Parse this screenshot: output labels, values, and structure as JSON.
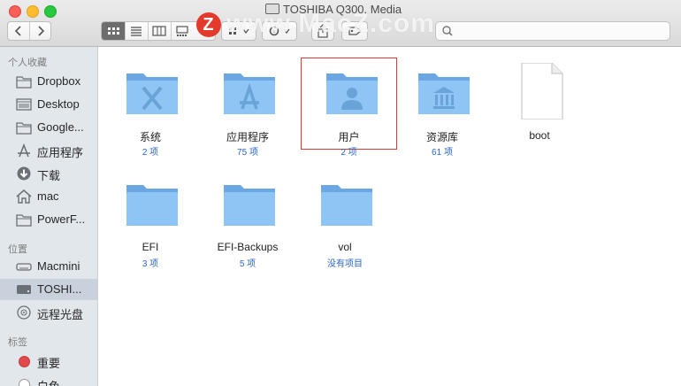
{
  "window": {
    "title": "TOSHIBA Q300. Media"
  },
  "watermark": {
    "badge": "Z",
    "text": "www.MacZ.com"
  },
  "search": {
    "value": "",
    "placeholder": ""
  },
  "colors": {
    "folder": "#7cb8ef",
    "sidebar_bg": "#e2e7ec",
    "selected_row": "#c9d2dc",
    "count_blue": "#2a66c8",
    "highlight_box": "#d63a3a",
    "tag_red": "#e14a4a"
  },
  "sidebar": {
    "favorites_header": "个人收藏",
    "favorites": [
      {
        "label": "Dropbox",
        "icon": "folder-icon"
      },
      {
        "label": "Desktop",
        "icon": "desktop-icon"
      },
      {
        "label": "Google...",
        "icon": "folder-icon"
      },
      {
        "label": "应用程序",
        "icon": "applications-icon"
      },
      {
        "label": "下载",
        "icon": "download-icon"
      },
      {
        "label": "mac",
        "icon": "home-icon"
      },
      {
        "label": "PowerF...",
        "icon": "folder-icon"
      }
    ],
    "locations_header": "位置",
    "locations": [
      {
        "label": "Macmini",
        "icon": "computer-icon",
        "selected": false
      },
      {
        "label": "TOSHI...",
        "icon": "disk-icon",
        "selected": true
      },
      {
        "label": "远程光盘",
        "icon": "optical-disc-icon",
        "selected": false
      }
    ],
    "tags_header": "标签",
    "tags": [
      {
        "label": "重要",
        "color": "#e14a4a"
      },
      {
        "label": "白色",
        "color": "#ffffff"
      }
    ]
  },
  "files": [
    {
      "name": "系统",
      "count": "2 项",
      "glyph": "X",
      "kind": "folder"
    },
    {
      "name": "应用程序",
      "count": "75 项",
      "glyph": "A",
      "kind": "folder"
    },
    {
      "name": "用户",
      "count": "2 项",
      "glyph": "user",
      "kind": "folder",
      "highlight": true
    },
    {
      "name": "资源库",
      "count": "61 项",
      "glyph": "library",
      "kind": "folder"
    },
    {
      "name": "boot",
      "count": "",
      "glyph": "",
      "kind": "file"
    },
    {
      "name": "EFI",
      "count": "3 项",
      "glyph": "",
      "kind": "folder"
    },
    {
      "name": "EFI-Backups",
      "count": "5 项",
      "glyph": "",
      "kind": "folder"
    },
    {
      "name": "vol",
      "count": "没有项目",
      "glyph": "",
      "kind": "folder"
    }
  ]
}
